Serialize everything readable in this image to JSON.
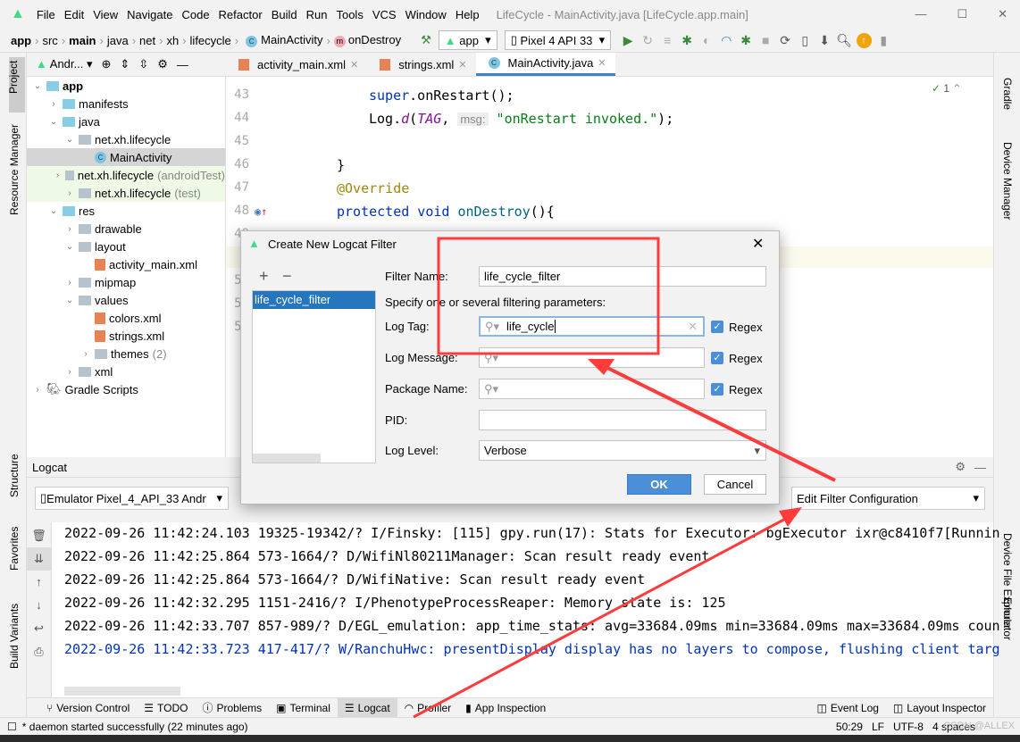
{
  "window": {
    "menus": [
      "File",
      "Edit",
      "View",
      "Navigate",
      "Code",
      "Refactor",
      "Build",
      "Run",
      "Tools",
      "VCS",
      "Window",
      "Help"
    ],
    "title": "LifeCycle - MainActivity.java [LifeCycle.app.main]"
  },
  "breadcrumb": [
    "app",
    "src",
    "main",
    "java",
    "net",
    "xh",
    "lifecycle",
    "MainActivity",
    "onDestroy"
  ],
  "run_config": "app",
  "device": "Pixel 4 API 33",
  "left_strip": [
    "Project",
    "Resource Manager",
    "Structure",
    "Favorites",
    "Build Variants"
  ],
  "right_strip": [
    "Gradle",
    "Device Manager",
    "Device File Explorer",
    "Emulator"
  ],
  "project": {
    "view": "Andr...",
    "tree": [
      {
        "label": "app",
        "depth": 0,
        "open": true,
        "bold": true
      },
      {
        "label": "manifests",
        "depth": 1
      },
      {
        "label": "java",
        "depth": 1,
        "open": true
      },
      {
        "label": "net.xh.lifecycle",
        "depth": 2,
        "open": true
      },
      {
        "label": "MainActivity",
        "depth": 3,
        "type": "class",
        "selected": true
      },
      {
        "label": "net.xh.lifecycle",
        "suffix": "(androidTest)",
        "depth": 2,
        "test": true
      },
      {
        "label": "net.xh.lifecycle",
        "suffix": "(test)",
        "depth": 2,
        "test": true
      },
      {
        "label": "res",
        "depth": 1,
        "open": true
      },
      {
        "label": "drawable",
        "depth": 2
      },
      {
        "label": "layout",
        "depth": 2,
        "open": true
      },
      {
        "label": "activity_main.xml",
        "depth": 3,
        "type": "xml"
      },
      {
        "label": "mipmap",
        "depth": 2
      },
      {
        "label": "values",
        "depth": 2,
        "open": true
      },
      {
        "label": "colors.xml",
        "depth": 3,
        "type": "xml"
      },
      {
        "label": "strings.xml",
        "depth": 3,
        "type": "xml"
      },
      {
        "label": "themes",
        "suffix": "(2)",
        "depth": 3
      },
      {
        "label": "xml",
        "depth": 2
      },
      {
        "label": "Gradle Scripts",
        "depth": 0
      }
    ]
  },
  "tabs": [
    {
      "label": "activity_main.xml"
    },
    {
      "label": "strings.xml"
    },
    {
      "label": "MainActivity.java",
      "active": true
    }
  ],
  "editor": {
    "inspection": "1",
    "lines": [
      "43",
      "44",
      "45",
      "46",
      "47",
      "48",
      "49",
      "50",
      "51",
      "52",
      "53"
    ],
    "code": {
      "l43": "super.onRestart();",
      "l44a": "Log.",
      "l44b": "d",
      "l44c": "(",
      "l44d": "TAG",
      ", ": ", ",
      "hint": "msg:",
      "l44e": "\"onRestart invoked.\"",
      "l44f": ");",
      "l46": "}",
      "l47": "@Override",
      "l48a": "protected void ",
      "l48b": "onDestroy",
      "l48c": "(){"
    }
  },
  "logcat": {
    "title": "Logcat",
    "device": "Emulator Pixel_4_API_33 Andr",
    "filter": "Edit Filter Configuration",
    "lines": [
      {
        "text": "2022-09-26 11:42:24.103 19325-19342/? I/Finsky: [115] gpy.run(17): Stats for Executor: bgExecutor ixr@c8410f7[Runnin",
        "level": "I"
      },
      {
        "text": "2022-09-26 11:42:25.864 573-1664/? D/WifiNl80211Manager: Scan result ready event",
        "level": "D"
      },
      {
        "text": "2022-09-26 11:42:25.864 573-1664/? D/WifiNative: Scan result ready event",
        "level": "D"
      },
      {
        "text": "2022-09-26 11:42:32.295 1151-2416/? I/PhenotypeProcessReaper: Memory state is: 125",
        "level": "I"
      },
      {
        "text": "2022-09-26 11:42:33.707 857-989/? D/EGL_emulation: app_time_stats: avg=33684.09ms min=33684.09ms max=33684.09ms coun",
        "level": "D"
      },
      {
        "text": "2022-09-26 11:42:33.723 417-417/? W/RanchuHwc: presentDisplay display has no layers to compose, flushing client targ",
        "level": "W"
      }
    ]
  },
  "bottom_tabs": [
    "Version Control",
    "TODO",
    "Problems",
    "Terminal",
    "Logcat",
    "Profiler",
    "App Inspection"
  ],
  "bottom_right_tabs": [
    "Event Log",
    "Layout Inspector"
  ],
  "status": {
    "message": "* daemon started successfully (22 minutes ago)",
    "position": "50:29",
    "line_sep": "LF",
    "encoding": "UTF-8",
    "indent": "4 spaces",
    "watermark": "CSDN @ALLEX"
  },
  "dialog": {
    "title": "Create New Logcat Filter",
    "add": "+",
    "remove": "−",
    "filters": [
      "life_cycle_filter"
    ],
    "filter_name_label": "Filter Name:",
    "filter_name": "life_cycle_filter",
    "hint": "Specify one or several filtering parameters:",
    "log_tag_label": "Log Tag:",
    "log_tag": "life_cycle",
    "log_message_label": "Log Message:",
    "log_message": "",
    "package_label": "Package Name:",
    "package": "",
    "pid_label": "PID:",
    "pid": "",
    "level_label": "Log Level:",
    "level": "Verbose",
    "regex": "Regex",
    "regex_checked": [
      true,
      true,
      true
    ],
    "ok": "OK",
    "cancel": "Cancel"
  },
  "colors": {
    "accent": "#4a8fd8",
    "annotation": "#ff3b3b",
    "warn_log": "#0033b3"
  }
}
